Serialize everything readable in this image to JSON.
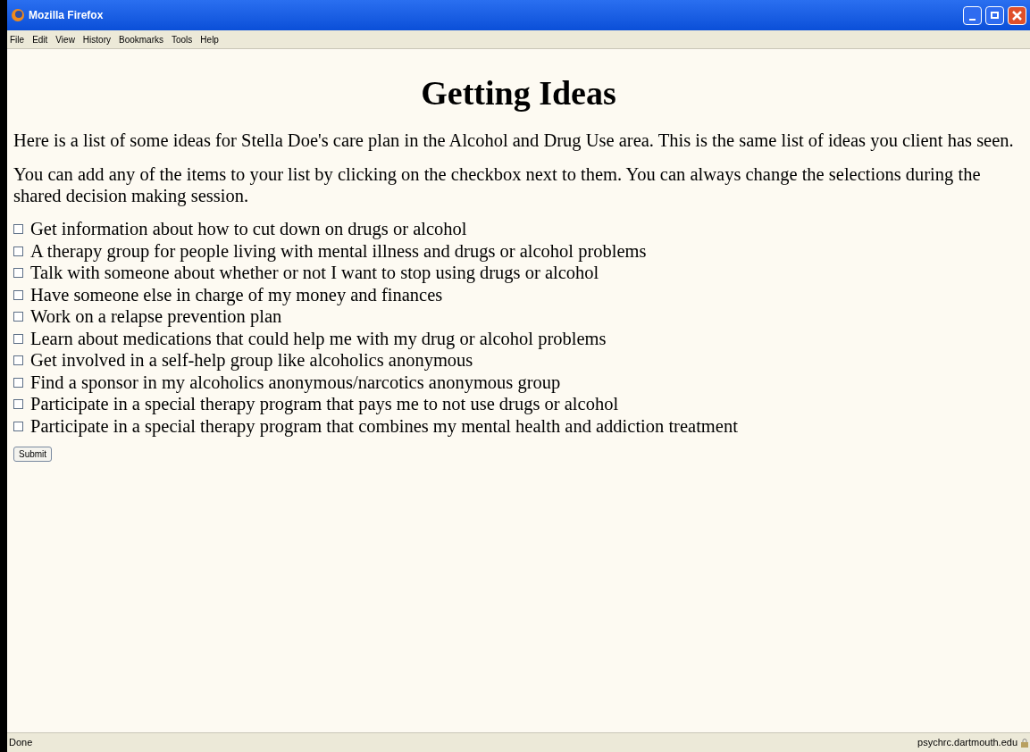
{
  "window": {
    "title": "Mozilla Firefox"
  },
  "menu": [
    "File",
    "Edit",
    "View",
    "History",
    "Bookmarks",
    "Tools",
    "Help"
  ],
  "page": {
    "heading": "Getting Ideas",
    "paragraphs": [
      "Here is a list of some ideas for Stella Doe's care plan in the Alcohol and Drug Use area. This is the same list of ideas you client has seen.",
      "You can add any of the items to your list by clicking on the checkbox next to them. You can always change the selections during the shared decision making session."
    ],
    "ideas": [
      {
        "label": "Get information about how to cut down on drugs or alcohol",
        "checked": false
      },
      {
        "label": "A therapy group for people living with mental illness and drugs or alcohol problems",
        "checked": false
      },
      {
        "label": "Talk with someone about whether or not I want to stop using drugs or alcohol",
        "checked": false
      },
      {
        "label": "Have someone else in charge of my money and finances",
        "checked": false
      },
      {
        "label": "Work on a relapse prevention plan",
        "checked": false
      },
      {
        "label": "Learn about medications that could help me with my drug or alcohol problems",
        "checked": false
      },
      {
        "label": "Get involved in a self-help group like alcoholics anonymous",
        "checked": false
      },
      {
        "label": "Find a sponsor in my alcoholics anonymous/narcotics anonymous group",
        "checked": false
      },
      {
        "label": "Participate in a special therapy program that pays me to not use drugs or alcohol",
        "checked": false
      },
      {
        "label": "Participate in a special therapy program that combines my mental health and addiction treatment",
        "checked": false
      }
    ],
    "submit": "Submit"
  },
  "status_bar": {
    "status": "Done",
    "host": "psychrc.dartmouth.edu"
  }
}
